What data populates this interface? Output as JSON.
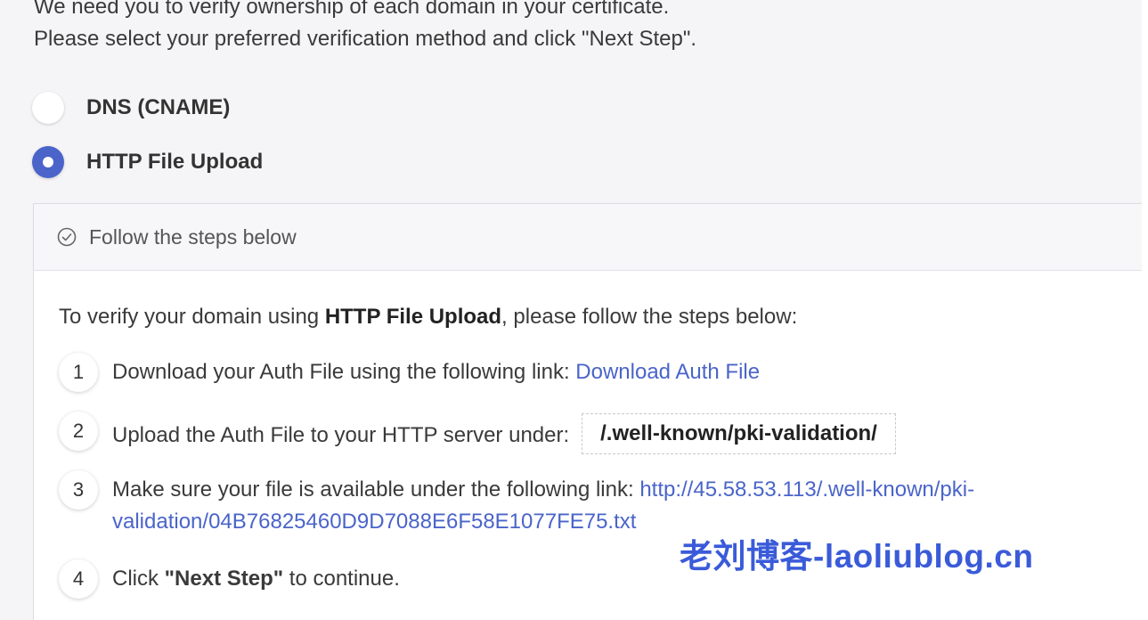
{
  "intro": {
    "line1": "We need you to verify ownership of each domain in your certificate.",
    "line2": "Please select your preferred verification method and click \"Next Step\"."
  },
  "methods": [
    {
      "label": "DNS (CNAME)",
      "checked": false
    },
    {
      "label": "HTTP File Upload",
      "checked": true
    }
  ],
  "panel": {
    "header": "Follow the steps below",
    "instruction_prefix": "To verify your domain using ",
    "instruction_bold": "HTTP File Upload",
    "instruction_suffix": ", please follow the steps below:",
    "steps": [
      {
        "num": "1",
        "text": "Download your Auth File using the following link: ",
        "link": "Download Auth File"
      },
      {
        "num": "2",
        "text": "Upload the Auth File to your HTTP server under:",
        "code": "/.well-known/pki-validation/"
      },
      {
        "num": "3",
        "text": "Make sure your file is available under the following link: ",
        "link_line1": "http://45.58.53.113/.well-known/pki-",
        "link_line2": "validation/04B76825460D9D7088E6F58E1077FE75.txt"
      },
      {
        "num": "4",
        "text_prefix": "Click ",
        "text_bold": "\"Next Step\"",
        "text_suffix": " to continue."
      }
    ]
  },
  "watermark": "老刘博客-laoliublog.cn",
  "colors": {
    "accent": "#4a64c9",
    "watermark": "#3a5bd9"
  }
}
